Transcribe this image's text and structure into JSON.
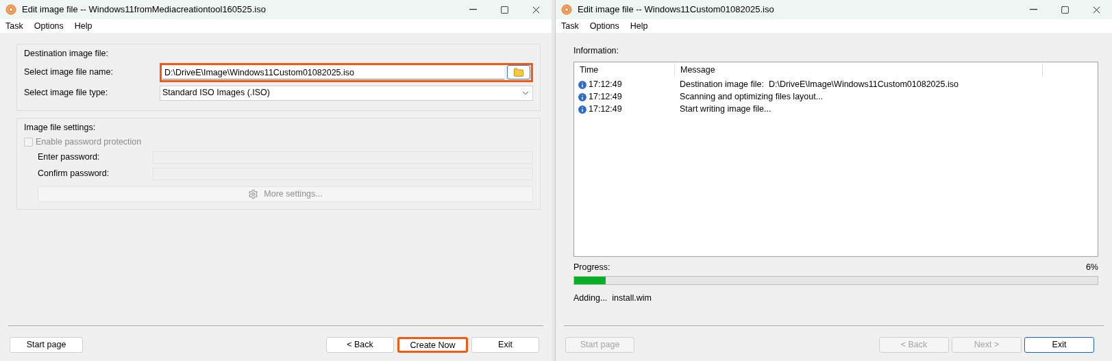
{
  "editor_window": {
    "title": "Edit image file -- Windows11fromMediacreationtool160525.iso",
    "menu": [
      "Task",
      "Options",
      "Help"
    ],
    "destination": {
      "heading": "Destination image file:",
      "fields": [
        {
          "kind": "file",
          "label": "Select image file name:",
          "value": "D:\\DriveE\\Image\\Windows11Custom01082025.iso",
          "highlighted": true
        },
        {
          "kind": "dropdown",
          "label": "Select image file type:",
          "value": "Standard ISO Images (.ISO)",
          "highlighted": false
        }
      ]
    },
    "settings": {
      "heading": "Image file settings:",
      "password_protection": {
        "label": "Enable password protection",
        "checked": false,
        "disabled": true
      },
      "fields": [
        {
          "label": "Enter password:",
          "disabled": true
        },
        {
          "label": "Confirm password:",
          "disabled": true
        }
      ],
      "more_button": {
        "label": "More settings...",
        "disabled": true
      }
    },
    "buttons": [
      {
        "label": "Start page",
        "disabled": false,
        "highlighted": false
      },
      {
        "label": "< Back",
        "disabled": false,
        "highlighted": false
      },
      {
        "label": "Create Now",
        "disabled": false,
        "highlighted": true
      },
      {
        "label": "Exit",
        "disabled": false,
        "highlighted": false
      }
    ]
  },
  "progress_window": {
    "title": "Edit image file -- Windows11Custom01082025.iso",
    "menu": [
      "Task",
      "Options",
      "Help"
    ],
    "information_label": "Information:",
    "log": {
      "columns": [
        "Time",
        "Message"
      ],
      "rows": [
        {
          "time": "17:12:49",
          "message": "Destination image file:  D:\\DriveE\\Image\\Windows11Custom01082025.iso"
        },
        {
          "time": "17:12:49",
          "message": "Scanning and optimizing files layout..."
        },
        {
          "time": "17:12:49",
          "message": "Start writing image file..."
        }
      ]
    },
    "progress": {
      "label": "Progress:",
      "reading": "6%",
      "level": 0.06
    },
    "status": "Adding...  install.wim",
    "buttons": [
      {
        "label": "Start page",
        "disabled": true,
        "focused": false
      },
      {
        "label": "< Back",
        "disabled": true,
        "focused": false
      },
      {
        "label": "Next >",
        "disabled": true,
        "focused": false
      },
      {
        "label": "Exit",
        "disabled": false,
        "focused": true
      }
    ]
  }
}
